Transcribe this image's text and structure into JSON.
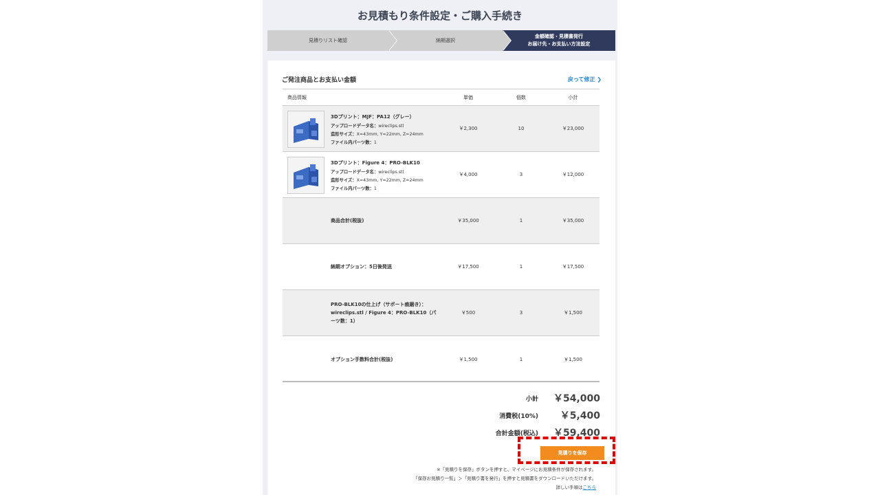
{
  "page": {
    "title": "お見積もり条件設定・ご購入手続き"
  },
  "steps": [
    {
      "label": "見積りリスト確認"
    },
    {
      "label": "納期選択"
    },
    {
      "line1": "金額確認・見積書発行",
      "line2": "お届け先・お支払い方法設定"
    }
  ],
  "section": {
    "title": "ご発注商品とお支払い金額",
    "back_link": "戻って修正"
  },
  "table": {
    "headers": {
      "info": "商品情報",
      "price": "単価",
      "qty": "個数",
      "subtotal": "小計"
    },
    "products": [
      {
        "name": "3Dプリント：MJF：PA12（グレー）",
        "upload_label": "アップロードデータ名：",
        "upload_value": "wireclips.stl",
        "size_label": "造形サイズ：",
        "size_value": "X=43mm, Y=22mm, Z=24mm",
        "parts_label": "ファイル内パーツ数：",
        "parts_value": "1",
        "price": "￥2,300",
        "qty": "10",
        "subtotal": "￥23,000"
      },
      {
        "name": "3Dプリント：Figure 4：PRO-BLK10",
        "upload_label": "アップロードデータ名：",
        "upload_value": "wireclips.stl",
        "size_label": "造形サイズ：",
        "size_value": "X=43mm, Y=22mm, Z=24mm",
        "parts_label": "ファイル内パーツ数：",
        "parts_value": "1",
        "price": "￥4,000",
        "qty": "3",
        "subtotal": "￥12,000"
      }
    ],
    "summary_rows": [
      {
        "label": "商品合計(税抜)",
        "price": "￥35,000",
        "qty": "1",
        "subtotal": "￥35,000"
      },
      {
        "label": "納期オプション：5日後発送",
        "price": "￥17,500",
        "qty": "1",
        "subtotal": "￥17,500"
      },
      {
        "label": "PRO-BLK10の仕上げ（サポート痕磨き）：wireclips.stl / Figure 4：PRO-BLK10（パーツ数：1）",
        "price": "￥500",
        "qty": "3",
        "subtotal": "￥1,500"
      },
      {
        "label": "オプション手数料合計(税抜)",
        "price": "￥1,500",
        "qty": "1",
        "subtotal": "￥1,500"
      }
    ]
  },
  "totals": {
    "subtotal_label": "小計",
    "subtotal_value": "￥54,000",
    "tax_label": "消費税(10%)",
    "tax_value": "￥5,400",
    "total_label": "合計金額(税込)",
    "total_value": "￥59,400"
  },
  "save_button": "見積りを保存",
  "notes": {
    "line1": "※「見積りを保存」ボタンを押すと、マイページにお見積条件が保存されます。",
    "line2": "「保存お見積り一覧」＞「見積り書を発行」を押すと見積書をダウンロードいただけます。",
    "line3_prefix": "詳しい手順は",
    "line3_link": "こちら"
  },
  "colors": {
    "accent_orange": "#f28c1e",
    "step_active": "#2f3a5c",
    "link_blue": "#2a8bd0",
    "highlight_red": "#e00000"
  },
  "icons": {
    "back": "chevron-right-icon",
    "thumbnail": "wire-clip-model-image"
  }
}
